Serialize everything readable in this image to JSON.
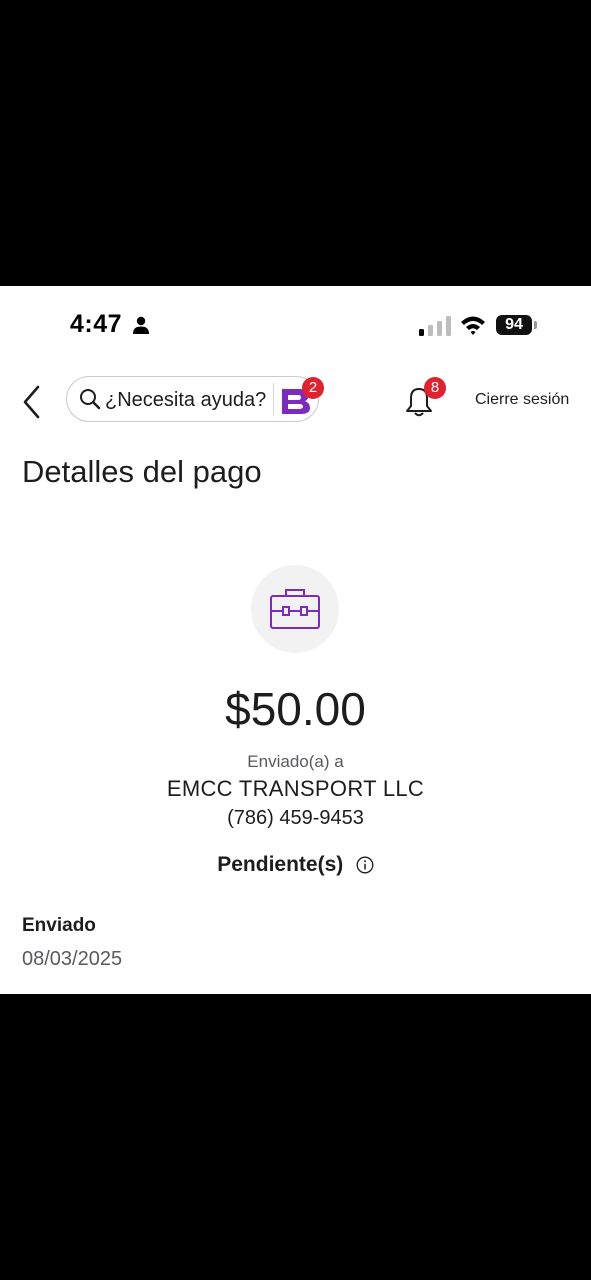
{
  "status_bar": {
    "time": "4:47",
    "battery": "94"
  },
  "header": {
    "search_placeholder": "¿Necesita ayuda?",
    "assistant_badge": "2",
    "notifications_badge": "8",
    "logout_label": "Cierre sesión"
  },
  "page": {
    "title": "Detalles del pago",
    "amount": "$50.00",
    "sent_to_label": "Enviado(a) a",
    "recipient": "EMCC TRANSPORT LLC",
    "phone": "(786) 459-9453",
    "status": "Pendiente(s)",
    "sent_label": "Enviado",
    "sent_date": "08/03/2025"
  },
  "colors": {
    "brand_purple": "#7b2cbf",
    "badge_red": "#e0222f"
  },
  "icons": [
    "person-icon",
    "signal-icon",
    "wifi-icon",
    "battery-icon",
    "back-icon",
    "search-icon",
    "assistant-icon",
    "bell-icon",
    "briefcase-icon",
    "info-icon"
  ]
}
